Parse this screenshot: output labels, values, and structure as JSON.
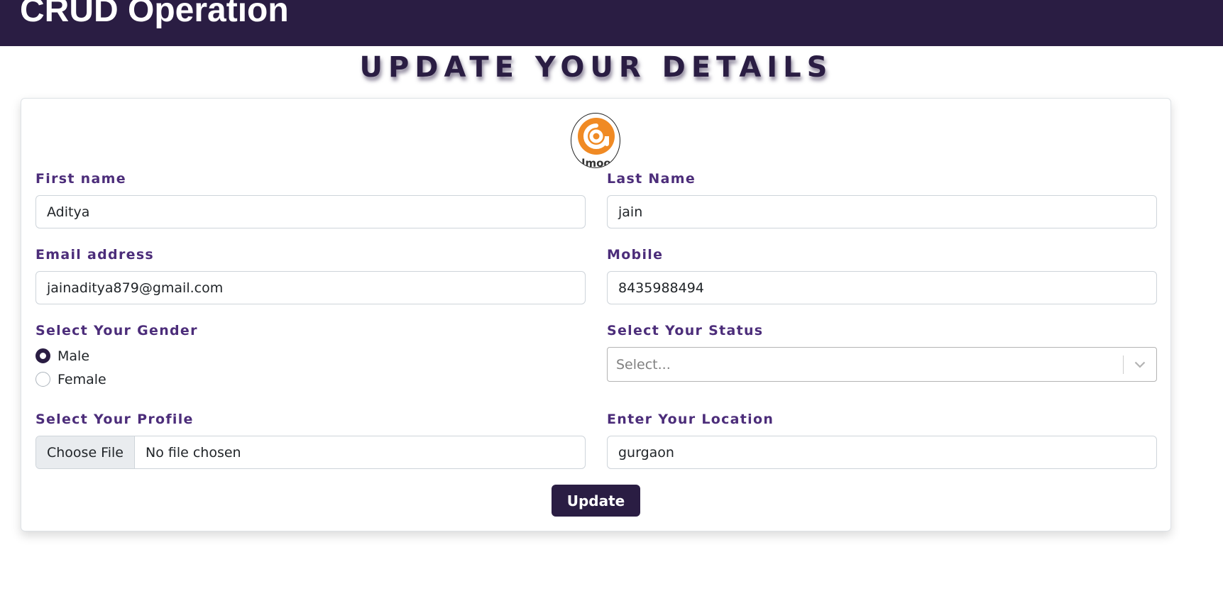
{
  "header": {
    "app_title": "CRUD Operation"
  },
  "page": {
    "heading": "UPDATE YOUR DETAILS"
  },
  "avatar": {
    "logo_text": "lmoo",
    "icon": "orange-a-logo"
  },
  "form": {
    "first_name": {
      "label": "First name",
      "value": "Aditya"
    },
    "last_name": {
      "label": "Last Name",
      "value": "jain"
    },
    "email": {
      "label": "Email address",
      "value": "jainaditya879@gmail.com"
    },
    "mobile": {
      "label": "Mobile",
      "value": "8435988494"
    },
    "gender": {
      "label": "Select Your Gender",
      "options": [
        {
          "label": "Male",
          "checked": true
        },
        {
          "label": "Female",
          "checked": false
        }
      ]
    },
    "status": {
      "label": "Select Your Status",
      "placeholder": "Select..."
    },
    "profile": {
      "label": "Select Your Profile",
      "button_label": "Choose File",
      "file_status": "No file chosen"
    },
    "location": {
      "label": "Enter Your Location",
      "value": "gurgaon"
    },
    "submit_label": "Update"
  },
  "colors": {
    "primary": "#2a1d43",
    "label": "#4c2d7a",
    "logo_orange": "#f08a24"
  }
}
